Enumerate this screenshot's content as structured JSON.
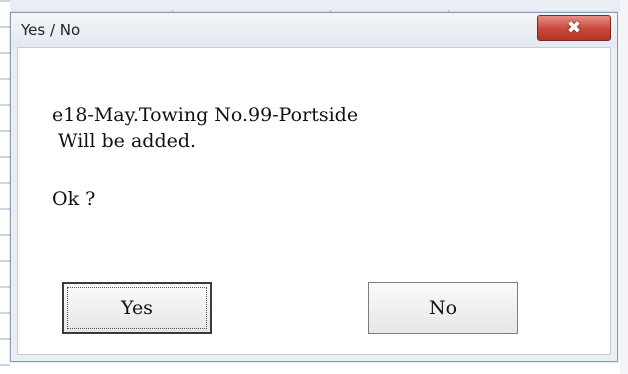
{
  "dialog": {
    "title": "Yes / No",
    "close_icon": "✖",
    "message": {
      "line1": "e18-May.Towing No.99-Portside",
      "line2": " Will be added.",
      "line3": "Ok ?"
    },
    "buttons": {
      "yes_label": "Yes",
      "no_label": "No"
    }
  },
  "colors": {
    "close_button": "#c8473a",
    "dialog_frame": "#e9eef5",
    "client_bg": "#ffffff"
  }
}
